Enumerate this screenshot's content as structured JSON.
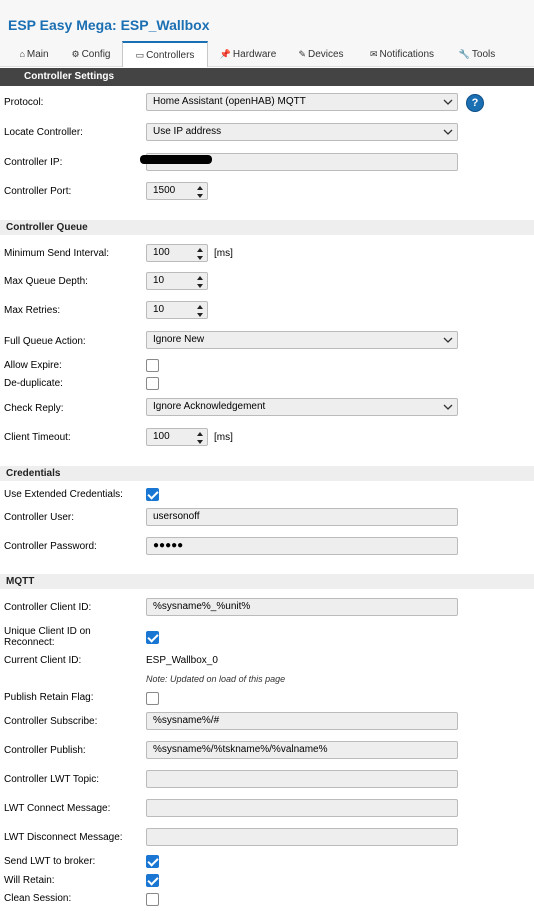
{
  "header": {
    "title": "ESP Easy Mega: ESP_Wallbox"
  },
  "tabs": [
    {
      "label": "Main",
      "icon": "⌂"
    },
    {
      "label": "Config",
      "icon": "⚙"
    },
    {
      "label": "Controllers",
      "icon": "▭"
    },
    {
      "label": "Hardware",
      "icon": "📌"
    },
    {
      "label": "Devices",
      "icon": "✎"
    },
    {
      "label": "Notifications",
      "icon": "✉"
    },
    {
      "label": "Tools",
      "icon": "🔧"
    }
  ],
  "active_tab": "Controllers",
  "sections": {
    "controller_settings": "Controller Settings",
    "controller_queue": "Controller Queue",
    "credentials": "Credentials",
    "mqtt": "MQTT"
  },
  "fields": {
    "protocol": {
      "label": "Protocol:",
      "value": "Home Assistant (openHAB) MQTT"
    },
    "locate": {
      "label": "Locate Controller:",
      "value": "Use IP address"
    },
    "ip": {
      "label": "Controller IP:",
      "value": "",
      "redacted": true
    },
    "port": {
      "label": "Controller Port:",
      "value": "1500"
    },
    "min_interval": {
      "label": "Minimum Send Interval:",
      "value": "100",
      "unit": "[ms]"
    },
    "max_queue": {
      "label": "Max Queue Depth:",
      "value": "10"
    },
    "max_retries": {
      "label": "Max Retries:",
      "value": "10"
    },
    "full_queue": {
      "label": "Full Queue Action:",
      "value": "Ignore New"
    },
    "allow_expire": {
      "label": "Allow Expire:",
      "checked": false
    },
    "dedup": {
      "label": "De-duplicate:",
      "checked": false
    },
    "check_reply": {
      "label": "Check Reply:",
      "value": "Ignore Acknowledgement"
    },
    "client_timeout": {
      "label": "Client Timeout:",
      "value": "100",
      "unit": "[ms]"
    },
    "ext_cred": {
      "label": "Use Extended Credentials:",
      "checked": true
    },
    "user": {
      "label": "Controller User:",
      "value": "usersonoff"
    },
    "password": {
      "label": "Controller Password:",
      "value": "●●●●●"
    },
    "client_id": {
      "label": "Controller Client ID:",
      "value": "%sysname%_%unit%"
    },
    "unique_id": {
      "label_line1": "Unique Client ID on",
      "label_line2": "Reconnect:",
      "checked": true
    },
    "current_id": {
      "label": "Current Client ID:",
      "value": "ESP_Wallbox_0",
      "note": "Note: Updated on load of this page"
    },
    "retain": {
      "label": "Publish Retain Flag:",
      "checked": false
    },
    "subscribe": {
      "label": "Controller Subscribe:",
      "value": "%sysname%/#"
    },
    "publish": {
      "label": "Controller Publish:",
      "value": "%sysname%/%tskname%/%valname%"
    },
    "lwt_topic": {
      "label": "Controller LWT Topic:",
      "value": ""
    },
    "lwt_connect": {
      "label": "LWT Connect Message:",
      "value": ""
    },
    "lwt_disconnect": {
      "label": "LWT Disconnect Message:",
      "value": ""
    },
    "send_lwt": {
      "label": "Send LWT to broker:",
      "checked": true
    },
    "will_retain": {
      "label": "Will Retain:",
      "checked": true
    },
    "clean_session": {
      "label": "Clean Session:",
      "checked": false
    }
  },
  "help_icon": "?",
  "colors": {
    "accent": "#1b6fb3",
    "checkbox": "#1976d2",
    "section_dark": "#444444"
  }
}
